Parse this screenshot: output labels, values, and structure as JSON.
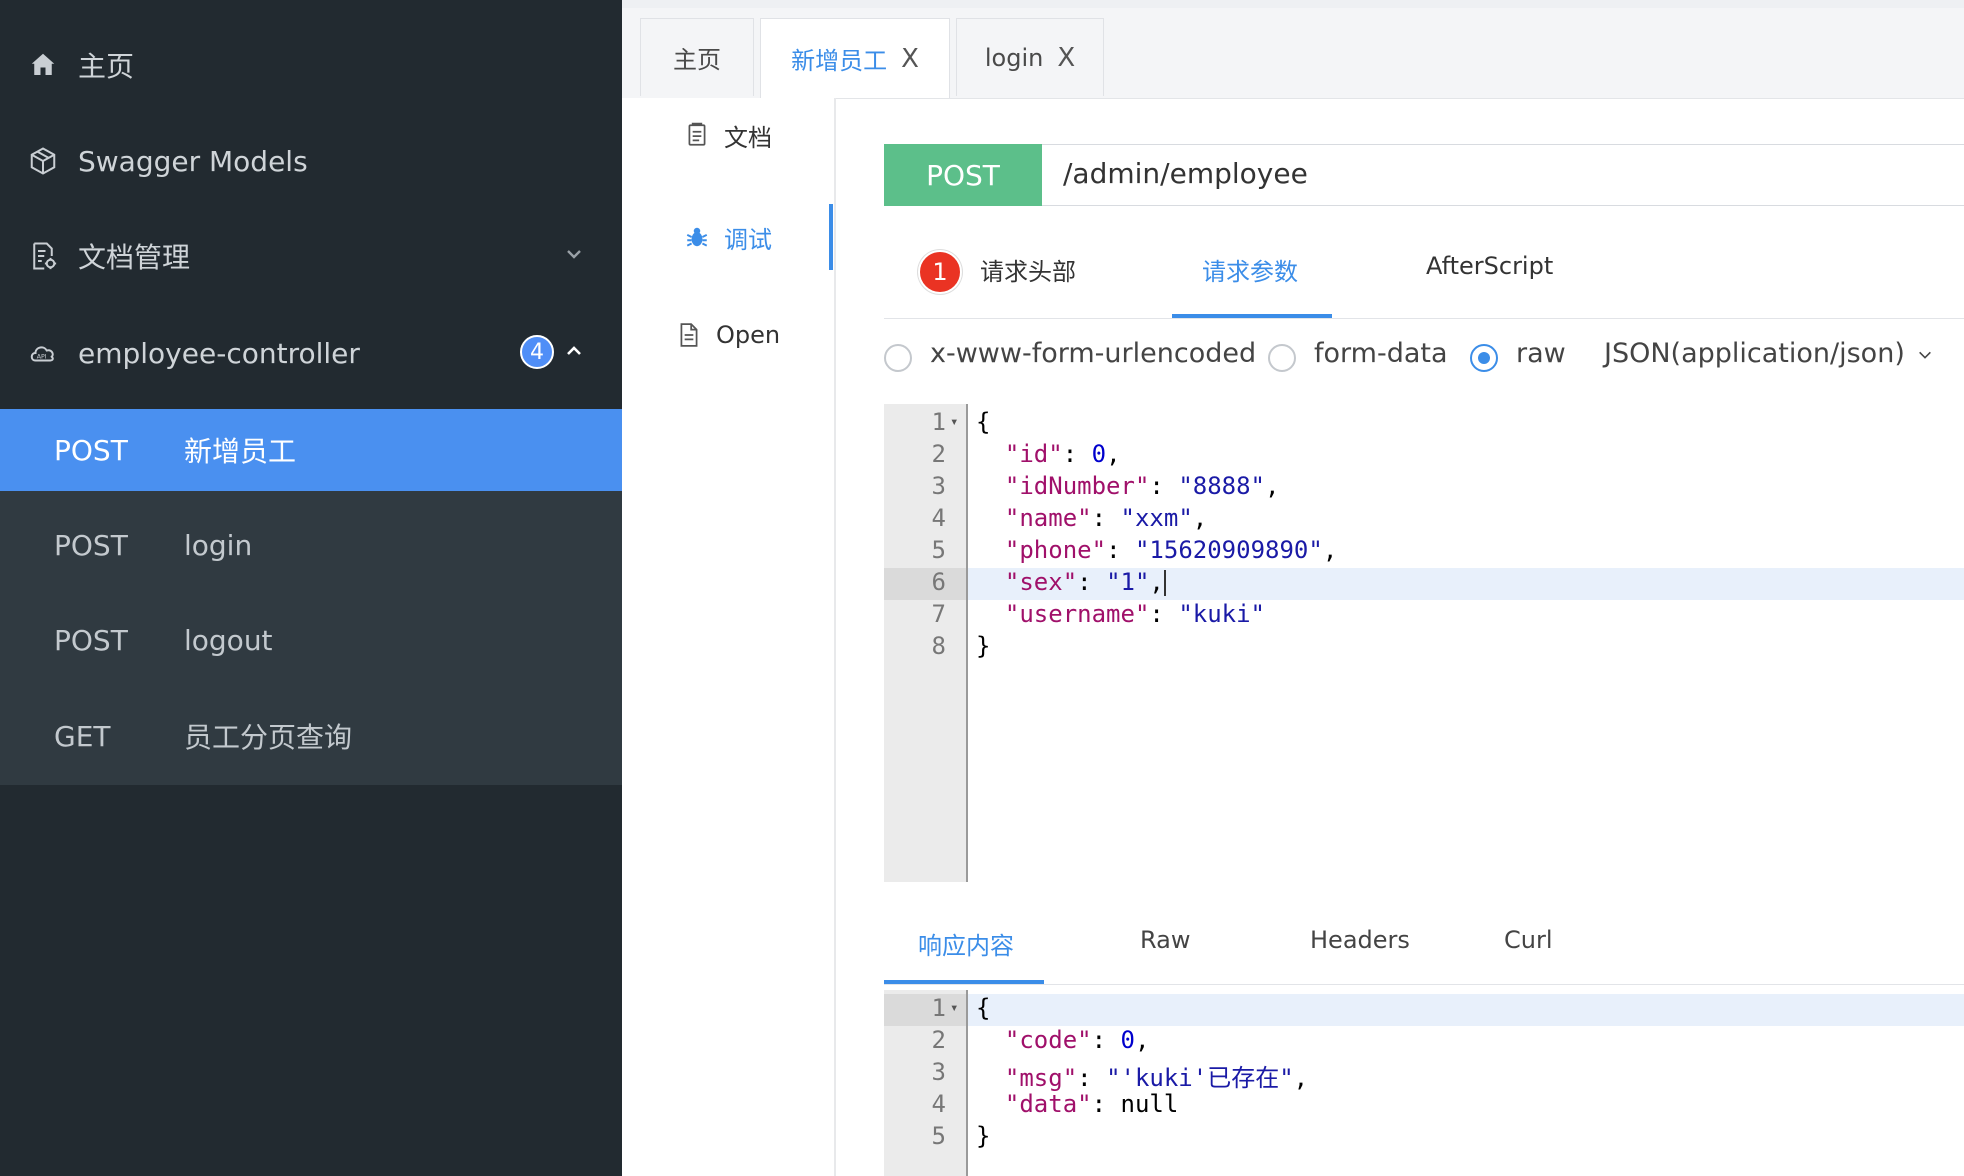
{
  "sidebar": {
    "items": [
      {
        "label": "主页",
        "icon": "home-icon"
      },
      {
        "label": "Swagger Models",
        "icon": "cube-icon"
      },
      {
        "label": "文档管理",
        "icon": "doc-settings-icon"
      },
      {
        "label": "employee-controller",
        "icon": "cloud-api-icon",
        "badge": "4"
      }
    ],
    "endpoints": [
      {
        "method": "POST",
        "name": "新增员工"
      },
      {
        "method": "POST",
        "name": "login"
      },
      {
        "method": "POST",
        "name": "logout"
      },
      {
        "method": "GET",
        "name": "员工分页查询"
      }
    ]
  },
  "tabs": [
    {
      "label": "主页"
    },
    {
      "label": "新增员工",
      "close": "X"
    },
    {
      "label": "login",
      "close": "X"
    }
  ],
  "leftnav": {
    "items": [
      {
        "label": "文档"
      },
      {
        "label": "调试"
      },
      {
        "label": "Open"
      }
    ]
  },
  "request": {
    "method": "POST",
    "url": "/admin/employee",
    "tabs": {
      "headers": "请求头部",
      "headers_badge": "1",
      "params": "请求参数",
      "afterscript": "AfterScript"
    },
    "body_types": {
      "urlencoded": "x-www-form-urlencoded",
      "formdata": "form-data",
      "raw": "raw",
      "content_type": "JSON(application/json)"
    },
    "lines": [
      {
        "n": "1",
        "t": "{"
      },
      {
        "n": "2",
        "k": "\"id\"",
        "p": ": ",
        "v": "0",
        "vt": "n",
        "e": ","
      },
      {
        "n": "3",
        "k": "\"idNumber\"",
        "p": ": ",
        "v": "\"8888\"",
        "vt": "s",
        "e": ","
      },
      {
        "n": "4",
        "k": "\"name\"",
        "p": ": ",
        "v": "\"xxm\"",
        "vt": "s",
        "e": ","
      },
      {
        "n": "5",
        "k": "\"phone\"",
        "p": ": ",
        "v": "\"15620909890\"",
        "vt": "s",
        "e": ","
      },
      {
        "n": "6",
        "k": "\"sex\"",
        "p": ": ",
        "v": "\"1\"",
        "vt": "s",
        "e": ","
      },
      {
        "n": "7",
        "k": "\"username\"",
        "p": ": ",
        "v": "\"kuki\"",
        "vt": "s",
        "e": ""
      },
      {
        "n": "8",
        "t": "}"
      }
    ]
  },
  "response": {
    "tabs": {
      "content": "响应内容",
      "raw": "Raw",
      "headers": "Headers",
      "curl": "Curl"
    },
    "lines": [
      {
        "n": "1",
        "t": "{"
      },
      {
        "n": "2",
        "k": "\"code\"",
        "p": ": ",
        "v": "0",
        "vt": "n",
        "e": ","
      },
      {
        "n": "3",
        "k": "\"msg\"",
        "p": ": ",
        "v": "\"'kuki'已存在\"",
        "vt": "s",
        "e": ","
      },
      {
        "n": "4",
        "k": "\"data\"",
        "p": ": ",
        "v": "null",
        "vt": "p",
        "e": ""
      },
      {
        "n": "5",
        "t": "}"
      }
    ]
  },
  "colors": {
    "accent": "#3b8de8",
    "post_method": "#5cbf8a",
    "sidebar_bg": "#222a30",
    "error_badge": "#ea3323"
  }
}
